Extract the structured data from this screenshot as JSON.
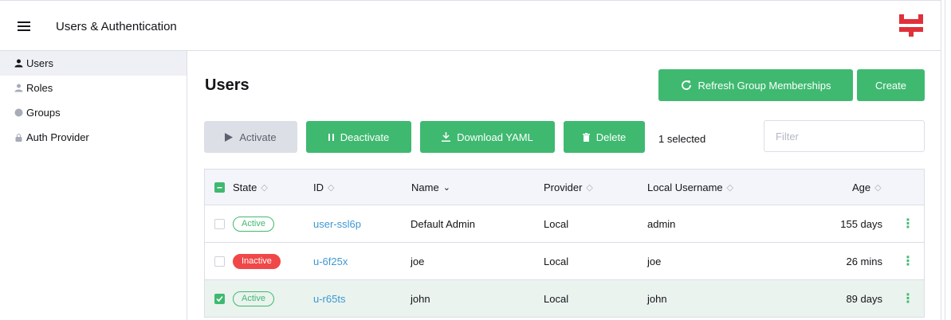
{
  "header": {
    "title": "Users & Authentication",
    "brand_color": "#e0303a"
  },
  "sidebar": {
    "items": [
      {
        "label": "Users",
        "icon": "user-icon",
        "active": true
      },
      {
        "label": "Roles",
        "icon": "user-icon",
        "active": false
      },
      {
        "label": "Groups",
        "icon": "globe-icon",
        "active": false
      },
      {
        "label": "Auth Provider",
        "icon": "lock-icon",
        "active": false
      }
    ]
  },
  "main": {
    "title": "Users",
    "refresh_label": "Refresh Group Memberships",
    "create_label": "Create"
  },
  "toolbar": {
    "activate_label": "Activate",
    "deactivate_label": "Deactivate",
    "download_label": "Download YAML",
    "delete_label": "Delete",
    "selected_text": "1 selected",
    "filter_placeholder": "Filter"
  },
  "table": {
    "columns": {
      "state": "State",
      "id": "ID",
      "name": "Name",
      "provider": "Provider",
      "local_username": "Local Username",
      "age": "Age"
    },
    "rows": [
      {
        "state": "Active",
        "state_kind": "active",
        "id": "user-ssl6p",
        "name": "Default Admin",
        "provider": "Local",
        "username": "admin",
        "age": "155 days",
        "checked": false
      },
      {
        "state": "Inactive",
        "state_kind": "inactive",
        "id": "u-6f25x",
        "name": "joe",
        "provider": "Local",
        "username": "joe",
        "age": "26 mins",
        "checked": false
      },
      {
        "state": "Active",
        "state_kind": "active",
        "id": "u-r65ts",
        "name": "john",
        "provider": "Local",
        "username": "john",
        "age": "89 days",
        "checked": true
      }
    ]
  },
  "colors": {
    "accent": "#3fb970",
    "link": "#3d98d3",
    "danger": "#f04848"
  }
}
